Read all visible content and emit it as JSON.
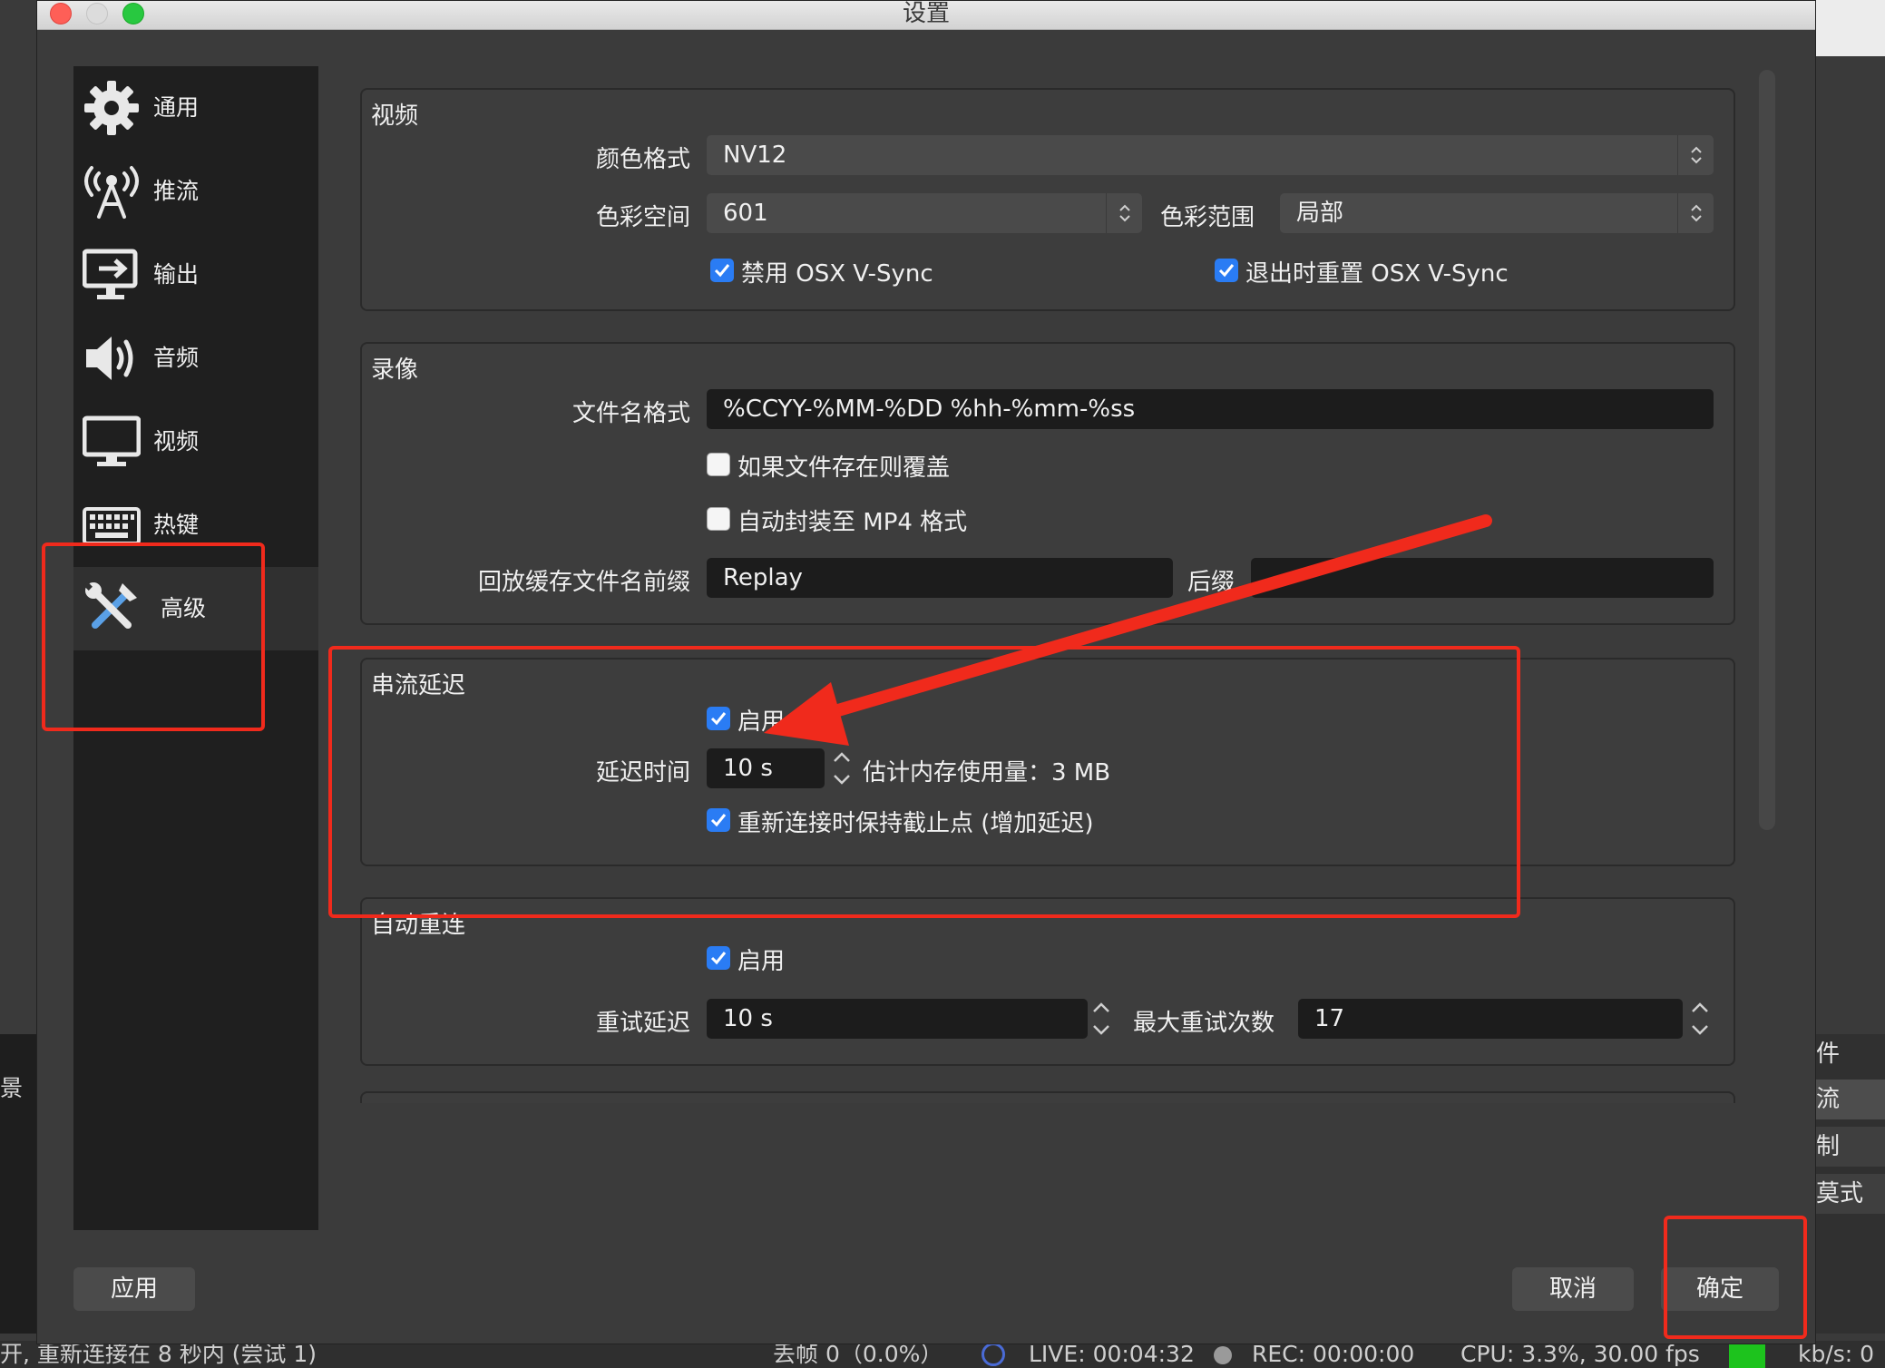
{
  "background": {
    "left_label": "景",
    "right_items": [
      "件",
      "流",
      "制",
      "莫式"
    ],
    "statusbar": {
      "reconnect": "开, 重新连接在 8 秒内 (尝试 1)",
      "dropped": "丢帧 0（0.0%）",
      "live": "LIVE: 00:04:32",
      "rec": "REC: 00:00:00",
      "cpu": "CPU: 3.3%, 30.00 fps",
      "kbs": "kb/s: 0"
    }
  },
  "window": {
    "title": "设置"
  },
  "sidebar": {
    "items": [
      {
        "label": "通用",
        "icon": "gear-icon"
      },
      {
        "label": "推流",
        "icon": "antenna-icon"
      },
      {
        "label": "输出",
        "icon": "output-monitor-icon"
      },
      {
        "label": "音频",
        "icon": "speaker-icon"
      },
      {
        "label": "视频",
        "icon": "monitor-icon"
      },
      {
        "label": "热键",
        "icon": "keyboard-icon"
      },
      {
        "label": "高级",
        "icon": "tools-icon"
      }
    ],
    "active": "高级"
  },
  "video": {
    "title": "视频",
    "color_format_label": "颜色格式",
    "color_format_value": "NV12",
    "color_space_label": "色彩空间",
    "color_space_value": "601",
    "color_range_label": "色彩范围",
    "color_range_value": "局部",
    "disable_vsync_label": "禁用 OSX V-Sync",
    "disable_vsync_checked": true,
    "reset_vsync_label": "退出时重置 OSX V-Sync",
    "reset_vsync_checked": true
  },
  "recording": {
    "title": "录像",
    "filename_label": "文件名格式",
    "filename_value": "%CCYY-%MM-%DD %hh-%mm-%ss",
    "overwrite_label": "如果文件存在则覆盖",
    "overwrite_checked": false,
    "automux_label": "自动封装至 MP4 格式",
    "automux_checked": false,
    "replay_prefix_label": "回放缓存文件名前缀",
    "replay_prefix_value": "Replay",
    "suffix_label": "后缀",
    "suffix_value": ""
  },
  "stream_delay": {
    "title": "串流延迟",
    "enable_label": "启用",
    "enable_checked": true,
    "duration_label": "延迟时间",
    "duration_value": "10 s",
    "memory_label": "估计内存使用量：3 MB",
    "preserve_label": "重新连接时保持截止点 (增加延迟)",
    "preserve_checked": true
  },
  "auto_reconnect": {
    "title": "自动重连",
    "enable_label": "启用",
    "enable_checked": true,
    "retry_delay_label": "重试延迟",
    "retry_delay_value": "10 s",
    "max_retries_label": "最大重试次数",
    "max_retries_value": "17"
  },
  "buttons": {
    "apply": "应用",
    "cancel": "取消",
    "ok": "确定"
  },
  "colors": {
    "annotation": "#f02a1c",
    "checkbox_on": "#2a7cf4",
    "live_indicator": "#4a6bd6",
    "status_green": "#1dc31d"
  }
}
